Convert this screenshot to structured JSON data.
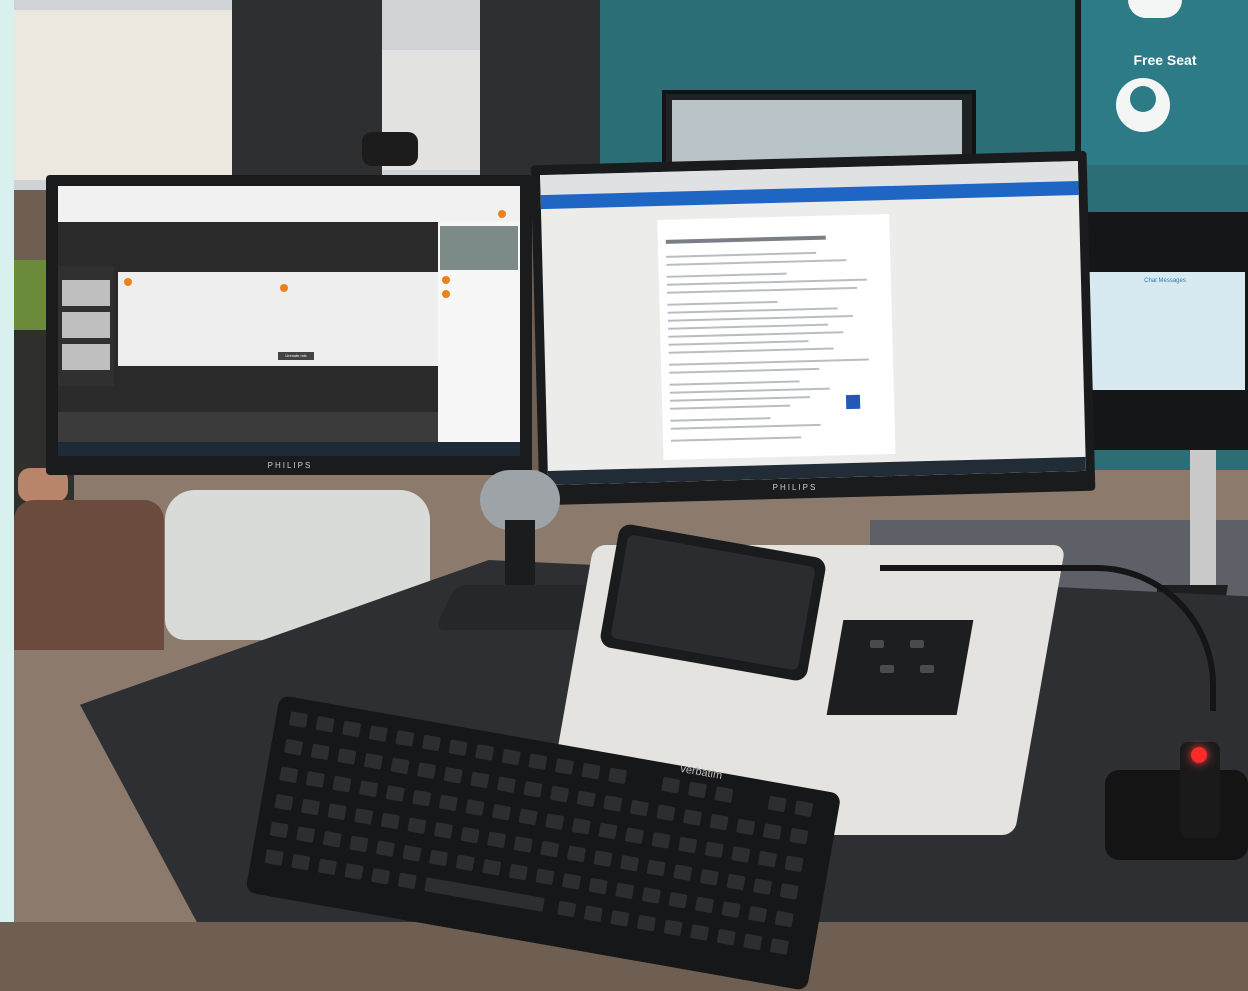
{
  "scene": {
    "back_screen_label": "Free Seat",
    "side_screen_label": "Chat Messages",
    "monitor_brand": "PHILIPS",
    "keyboard_brand": "verbatim"
  },
  "left_screen": {
    "url_text": "",
    "button_label": "Unmute mic"
  },
  "right_screen": {
    "bluebar_text": ""
  },
  "colors": {
    "teal_wall": "#2b6e76",
    "led_red": "#ff2a2a",
    "browser_blue": "#1f66c4"
  }
}
